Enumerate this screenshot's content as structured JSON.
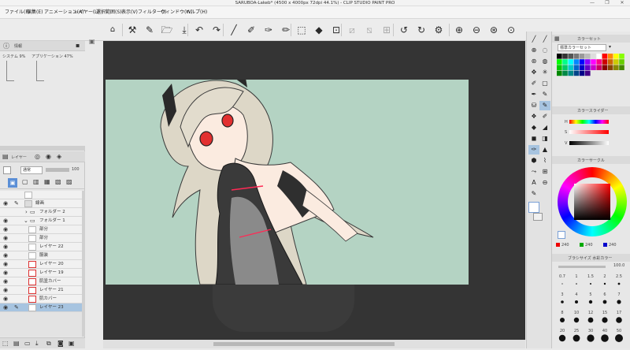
{
  "window": {
    "title": "SARUBOA-Lakeb* (4500 x 4000px 72dpi 44.1%) - CLIP STUDIO PAINT PRO",
    "controls": [
      "—",
      "❐",
      "✕"
    ]
  },
  "menubar": {
    "items": [
      "ファイル(F)",
      "編集(E)",
      "アニメーション(A)",
      "レイヤー(L)",
      "選択範囲(S)",
      "表示(V)",
      "フィルター(I)",
      "ウィンドウ(W)",
      "ヘルプ(H)"
    ]
  },
  "toolbar": {
    "icons": [
      "clip-studio-icon",
      "tool-settings-icon",
      "brush-size-icon",
      "new-file-icon",
      "open-icon",
      "save-icon",
      "undo-icon",
      "redo-icon",
      "pen-icon",
      "eraser-icon",
      "brush-icon",
      "pencil-icon",
      "selection-icon",
      "fill-icon",
      "transform-icon",
      "crop-icon",
      "snap-1-icon",
      "snap-2-icon",
      "snap-3-icon",
      "rotate-left-icon",
      "rotate-right-icon",
      "canvas-settings-icon",
      "zoom-in-icon",
      "zoom-out-icon",
      "fit-icon",
      "reset-icon"
    ]
  },
  "nav_panel": {
    "header_label": "情報",
    "col_a": "システム 9%",
    "col_b": "アプリケーション 47%"
  },
  "layers": {
    "header_tabs": [
      "レイヤー",
      "",
      ""
    ],
    "blend_mode": "通常",
    "opacity": "100",
    "rows": [
      {
        "name": "",
        "icon": "layer-thumb"
      },
      {
        "name": "線画",
        "icon": "folder-thumb"
      },
      {
        "name": "フォルダー 2",
        "icon": "folder-icon"
      },
      {
        "name": "フォルダー 1",
        "icon": "folder-icon"
      },
      {
        "name": "部分",
        "icon": "layer-thumb"
      },
      {
        "name": "部分",
        "icon": "layer-thumb"
      },
      {
        "name": "レイヤー 22",
        "icon": "layer-thumb"
      },
      {
        "name": "服装",
        "icon": "layer-thumb"
      },
      {
        "name": "レイヤー 20",
        "icon": "layer-thumb"
      },
      {
        "name": "レイヤー 19",
        "icon": "layer-thumb"
      },
      {
        "name": "肌塗カバー",
        "icon": "layer-thumb"
      },
      {
        "name": "レイヤー 21",
        "icon": "layer-thumb"
      },
      {
        "name": "肌カバー",
        "icon": "layer-thumb"
      },
      {
        "name": "レイヤー 23",
        "icon": "layer-thumb",
        "selected": true
      }
    ]
  },
  "right_panel": {
    "color_set_header": "カラーセット",
    "color_set_name": "標準カラーセット",
    "slider_header": "カラースライダー",
    "slider_labels": [
      "H",
      "S",
      "V"
    ],
    "wheel_header": "カラーサークル",
    "rgb_labels": [
      "R",
      "G",
      "B"
    ],
    "rgb_values": [
      "240",
      "240",
      "240"
    ],
    "brush_header": "ブラシサイズ 水彩カラー",
    "brush_value": "100.0",
    "brush_sizes": [
      "0.7",
      "1",
      "1.5",
      "2",
      "2.5",
      "3",
      "4",
      "5",
      "6",
      "7",
      "8",
      "10",
      "12",
      "15",
      "17",
      "20",
      "25",
      "30",
      "40",
      "50"
    ]
  },
  "palette": {
    "colors": [
      "#000000",
      "#333333",
      "#555555",
      "#777777",
      "#999999",
      "#bbbbbb",
      "#dddddd",
      "#ffffff",
      "#ff0000",
      "#ff8800",
      "#ffff00",
      "#88ff00",
      "#00ff00",
      "#00ff88",
      "#00ffff",
      "#0088ff",
      "#0000ff",
      "#8800ff",
      "#ff00ff",
      "#ff0088",
      "#cc0000",
      "#cc6600",
      "#cccc00",
      "#66cc00",
      "#00cc00",
      "#00cc66",
      "#00cccc",
      "#0066cc",
      "#0000cc",
      "#6600cc",
      "#cc00cc",
      "#cc0066",
      "#880000",
      "#884400",
      "#888800",
      "#448800",
      "#008800",
      "#008844",
      "#008888",
      "#004488",
      "#000088",
      "#440088"
    ]
  },
  "colors": {
    "paper": "#b4d3c3",
    "canvas_bg": "#343434",
    "selection": "#a7c4e0"
  }
}
